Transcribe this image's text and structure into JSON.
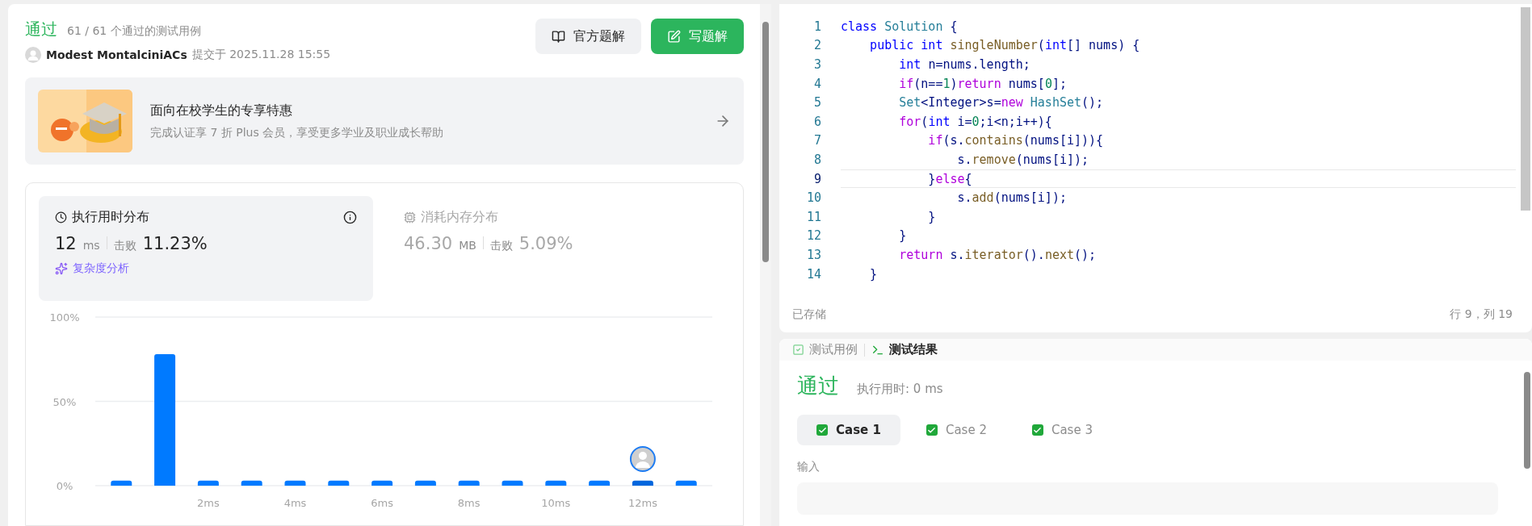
{
  "submission": {
    "status": "通过",
    "summary": "61 / 61 个通过的测试用例",
    "author": "Modest MontalciniACs",
    "submitted": "提交于 2025.11.28 15:55"
  },
  "buttons": [
    {
      "kind": "secondary",
      "label": "官方题解"
    },
    {
      "kind": "primary",
      "label": "写题解"
    }
  ],
  "promo": {
    "title": "面向在校学生的专享特惠",
    "subtitle": "完成认证享 7 折 Plus 会员，享受更多学业及职业成长帮助"
  },
  "stats": [
    {
      "title": "执行用时分布",
      "kind": "time",
      "selected": true,
      "value": "12",
      "unit": "ms",
      "beats_label": "击败",
      "beats": "11.23%",
      "link": "复杂度分析"
    },
    {
      "title": "消耗内存分布",
      "kind": "memory",
      "selected": false,
      "value": "46.30",
      "unit": "MB",
      "beats_label": "击败",
      "beats": "5.09%"
    }
  ],
  "chart_data": {
    "type": "bar",
    "x": [
      0,
      1,
      2,
      3,
      4,
      5,
      6,
      7,
      8,
      9,
      10,
      11,
      12,
      13
    ],
    "values": [
      3,
      78,
      3,
      3,
      3,
      3,
      3,
      3,
      3,
      3,
      3,
      3,
      3,
      3
    ],
    "ylim": [
      0,
      100
    ],
    "yticks": [
      {
        "value": 0,
        "label": "0%"
      },
      {
        "value": 50,
        "label": "50%"
      },
      {
        "value": 100,
        "label": "100%"
      }
    ],
    "xticks": [
      {
        "value": 2,
        "label": "2ms"
      },
      {
        "value": 4,
        "label": "4ms"
      },
      {
        "value": 6,
        "label": "6ms"
      },
      {
        "value": 8,
        "label": "8ms"
      },
      {
        "value": 10,
        "label": "10ms"
      },
      {
        "value": 12,
        "label": "12ms"
      }
    ],
    "xlim": [
      -0.6,
      13.6
    ]
  },
  "editor": {
    "lines": [
      {
        "number": "1",
        "current": false,
        "tokens": [
          {
            "kind": "keyword",
            "text": "class "
          },
          {
            "kind": "type",
            "text": "Solution"
          },
          {
            "kind": "plain",
            "text": " {"
          }
        ]
      },
      {
        "number": "2",
        "current": false,
        "tokens": [
          {
            "kind": "keyword",
            "text": "    public int "
          },
          {
            "kind": "function",
            "text": "singleNumber"
          },
          {
            "kind": "plain",
            "text": "("
          },
          {
            "kind": "keyword",
            "text": "int"
          },
          {
            "kind": "plain",
            "text": "[] nums) {"
          }
        ]
      },
      {
        "number": "3",
        "current": false,
        "tokens": [
          {
            "kind": "keyword",
            "text": "        int "
          },
          {
            "kind": "plain",
            "text": "n=nums.length;"
          }
        ]
      },
      {
        "number": "4",
        "current": false,
        "tokens": [
          {
            "kind": "control",
            "text": "        if"
          },
          {
            "kind": "plain",
            "text": "(n=="
          },
          {
            "kind": "number",
            "text": "1"
          },
          {
            "kind": "plain",
            "text": ")"
          },
          {
            "kind": "control",
            "text": "return"
          },
          {
            "kind": "plain",
            "text": " nums["
          },
          {
            "kind": "number",
            "text": "0"
          },
          {
            "kind": "plain",
            "text": "];"
          }
        ]
      },
      {
        "number": "5",
        "current": false,
        "tokens": [
          {
            "kind": "type",
            "text": "        Set"
          },
          {
            "kind": "plain",
            "text": "<Integer>s="
          },
          {
            "kind": "control",
            "text": "new "
          },
          {
            "kind": "type",
            "text": "HashSet"
          },
          {
            "kind": "plain",
            "text": "();"
          }
        ]
      },
      {
        "number": "6",
        "current": false,
        "tokens": [
          {
            "kind": "control",
            "text": "        for"
          },
          {
            "kind": "plain",
            "text": "("
          },
          {
            "kind": "keyword",
            "text": "int "
          },
          {
            "kind": "plain",
            "text": "i="
          },
          {
            "kind": "number",
            "text": "0"
          },
          {
            "kind": "plain",
            "text": ";i<n;i++){"
          }
        ]
      },
      {
        "number": "7",
        "current": false,
        "tokens": [
          {
            "kind": "control",
            "text": "            if"
          },
          {
            "kind": "plain",
            "text": "(s."
          },
          {
            "kind": "function",
            "text": "contains"
          },
          {
            "kind": "plain",
            "text": "(nums[i])){"
          }
        ]
      },
      {
        "number": "8",
        "current": false,
        "tokens": [
          {
            "kind": "plain",
            "text": "                s."
          },
          {
            "kind": "function",
            "text": "remove"
          },
          {
            "kind": "plain",
            "text": "(nums[i]);"
          }
        ]
      },
      {
        "number": "9",
        "current": true,
        "tokens": [
          {
            "kind": "plain",
            "text": "            }"
          },
          {
            "kind": "control",
            "text": "else"
          },
          {
            "kind": "plain",
            "text": "{"
          }
        ]
      },
      {
        "number": "10",
        "current": false,
        "tokens": [
          {
            "kind": "plain",
            "text": "                s."
          },
          {
            "kind": "function",
            "text": "add"
          },
          {
            "kind": "plain",
            "text": "(nums[i]);"
          }
        ]
      },
      {
        "number": "11",
        "current": false,
        "tokens": [
          {
            "kind": "plain",
            "text": "            }"
          }
        ]
      },
      {
        "number": "12",
        "current": false,
        "tokens": [
          {
            "kind": "plain",
            "text": "        }"
          }
        ]
      },
      {
        "number": "13",
        "current": false,
        "tokens": [
          {
            "kind": "control",
            "text": "        return "
          },
          {
            "kind": "plain",
            "text": "s."
          },
          {
            "kind": "function",
            "text": "iterator"
          },
          {
            "kind": "plain",
            "text": "()."
          },
          {
            "kind": "function",
            "text": "next"
          },
          {
            "kind": "plain",
            "text": "();"
          }
        ]
      },
      {
        "number": "14",
        "current": false,
        "tokens": [
          {
            "kind": "plain",
            "text": "    }"
          }
        ]
      }
    ],
    "saved": "已存储",
    "cursor": "行 9，列 19"
  },
  "console": {
    "tabs": [
      {
        "label": "测试用例",
        "kind": "cases",
        "selected": false
      },
      {
        "label": "测试结果",
        "kind": "result",
        "selected": true
      }
    ],
    "status": "通过",
    "runtime": "执行用时: 0 ms",
    "cases": [
      {
        "label": "Case 1",
        "passed": true,
        "selected": true
      },
      {
        "label": "Case 2",
        "passed": true,
        "selected": false
      },
      {
        "label": "Case 3",
        "passed": true,
        "selected": false
      }
    ],
    "input_label": "输入"
  }
}
